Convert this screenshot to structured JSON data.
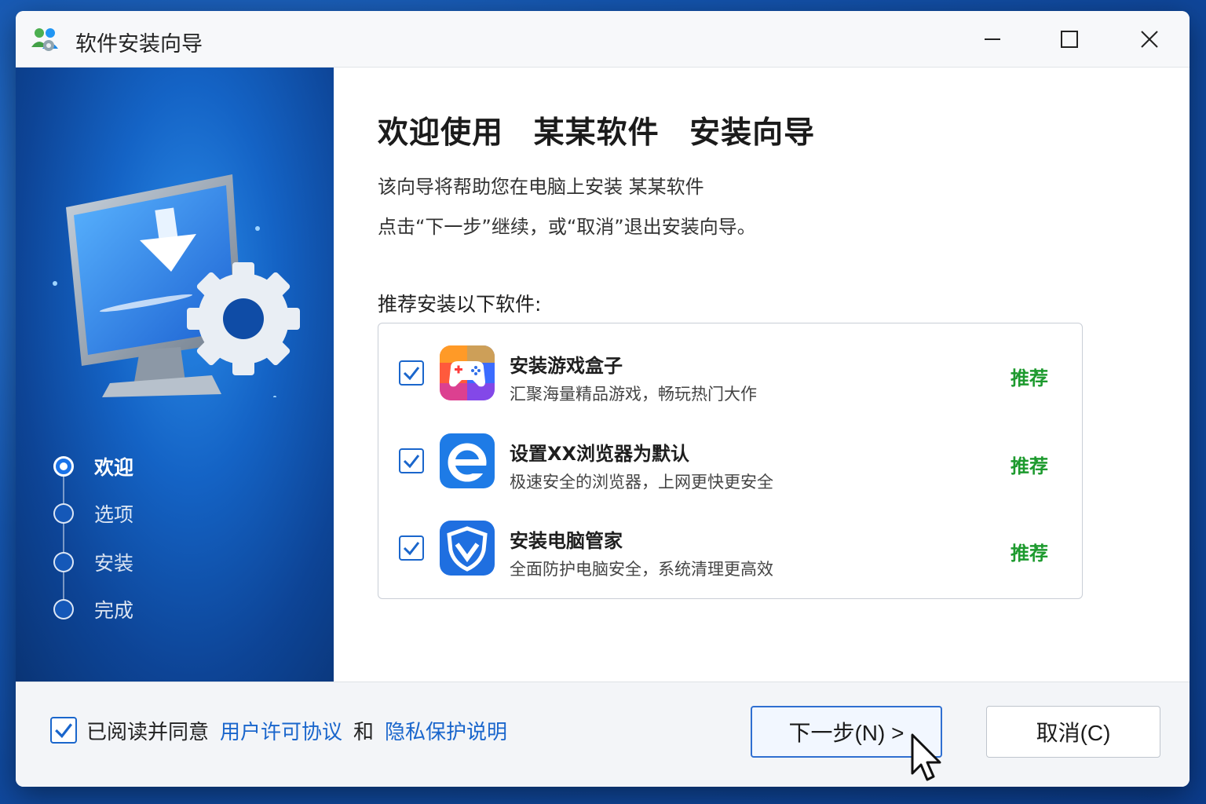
{
  "window": {
    "title": "软件安装向导",
    "app_icon": "installer-people-icon"
  },
  "sidebar": {
    "steps": [
      {
        "label": "欢迎",
        "active": true
      },
      {
        "label": "选项",
        "active": false
      },
      {
        "label": "安装",
        "active": false
      },
      {
        "label": "完成",
        "active": false
      }
    ]
  },
  "main": {
    "heading": "欢迎使用 某某软件 安装向导",
    "description_line1": "该向导将帮助您在电脑上安装 某某软件",
    "description_line2": "点击“下一步”继续，或“取消”退出安装向导。",
    "recommend_title": "推荐安装以下软件:",
    "recommend_items": [
      {
        "name": "安装游戏盒子",
        "desc": "汇聚海量精品游戏，畅玩热门大作",
        "tag": "推荐",
        "checked": true,
        "icon": "game-controller-icon"
      },
      {
        "name": "设置XX浏览器为默认",
        "desc": "极速安全的浏览器，上网更快更安全",
        "tag": "推荐",
        "checked": true,
        "icon": "browser-e-icon"
      },
      {
        "name": "安装电脑管家",
        "desc": "全面防护电脑安全，系统清理更高效",
        "tag": "推荐",
        "checked": true,
        "icon": "shield-icon"
      }
    ]
  },
  "footer": {
    "agree_checked": true,
    "agree_prefix": "已阅读并同意",
    "license_link": "用户许可协议",
    "conjunction": "和",
    "privacy_link": "隐私保护说明",
    "next_button": "下一步(N) >",
    "cancel_button": "取消(C)"
  },
  "colors": {
    "accent": "#1a66cc",
    "recommend_tag": "#1d9a2e",
    "sidebar_bg": "#1463c5"
  }
}
